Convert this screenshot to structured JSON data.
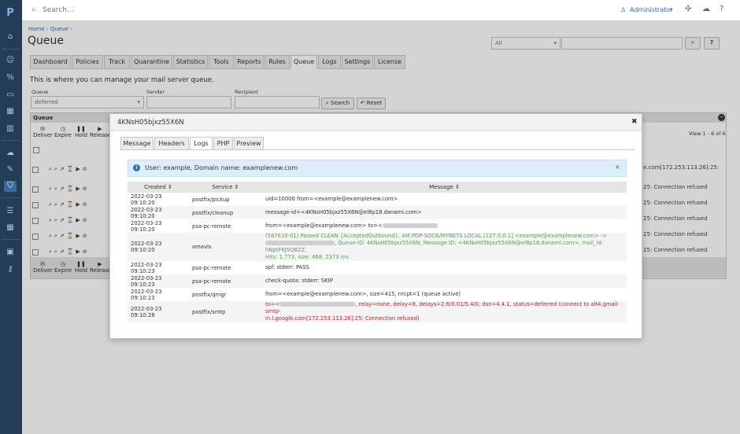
{
  "app": {
    "logo": "P"
  },
  "search": {
    "placeholder": "Search..."
  },
  "user": {
    "name": "Administrator"
  },
  "page": {
    "title": "Queue",
    "description": "This is where you can manage your mail server queue."
  },
  "breadcrumb": {
    "home": "Home",
    "current": "Queue"
  },
  "filter": {
    "select_value": "All"
  },
  "tabs": [
    "Dashboard",
    "Policies",
    "Track",
    "Quarantine",
    "Statistics",
    "Tools",
    "Reports",
    "Rules",
    "Queue",
    "Logs",
    "Settings",
    "License"
  ],
  "active_tab": "Queue",
  "form": {
    "queue_label": "Queue",
    "queue_value": "deferred",
    "sender_label": "Sender",
    "recipient_label": "Recipient",
    "search_btn": "Search",
    "reset_btn": "Reset"
  },
  "panel": {
    "title": "Queue",
    "pagination": "View 1 - 6 of 6"
  },
  "actions": {
    "deliver": "Deliver",
    "expire": "Expire",
    "hold": "Hold",
    "release": "Release"
  },
  "bg_rows": [
    "e.com[172.253.113.26]:25:",
    "25: Connection refused",
    "25: Connection refused",
    "25: Connection refused",
    "25: Connection refused",
    "25: Connection refused"
  ],
  "modal": {
    "title": "4KNsH05bjxz55X6N",
    "tabs": [
      "Message",
      "Headers",
      "Logs",
      "PHP",
      "Preview"
    ],
    "active_tab": "Logs",
    "info": "User: example, Domain name: examplenew.com",
    "columns": [
      "Created",
      "Service",
      "Message"
    ],
    "rows": [
      {
        "created": "2022-03-23 09:10:20",
        "service": "postfix/pickup",
        "message": "uid=10000 from=<example@examplenew.com>",
        "style": "normal"
      },
      {
        "created": "2022-03-23 09:10:20",
        "service": "postfix/cleanup",
        "message": "message-id=<4KNsH05bjxz55X6N@el8p18.danami.com>",
        "style": "normal"
      },
      {
        "created": "2022-03-23 09:10:20",
        "service": "psa-pc-remote",
        "message": "from=<example@examplenew.com> to=<",
        "style": "normal",
        "redacted": true
      },
      {
        "created": "2022-03-23 09:10:20",
        "service": "amavis",
        "message": "(587610-01) Passed CLEAN {AcceptedOutbound}, AM.PDP-SOCK/MYNETS LOCAL [127.0.0.1] <example@examplenew.com> ->",
        "message2": ", Queue-ID: 4KNsH05bjxz55X6N, Message-ID: <4KNsH05bjxz55X6N@el8p18.danami.com>, mail_id: hNptF6J5QBZZ,",
        "message3": "Hits: 1.773, size: 468, 2373 ms",
        "style": "green"
      },
      {
        "created": "2022-03-23 09:10:23",
        "service": "psa-pc-remote",
        "message": "spf: stderr: PASS",
        "style": "normal"
      },
      {
        "created": "2022-03-23 09:10:23",
        "service": "psa-pc-remote",
        "message": "check-quota: stderr: SKIP",
        "style": "normal"
      },
      {
        "created": "2022-03-23 09:10:23",
        "service": "postfix/qmgr",
        "message": "from=<example@examplenew.com>, size=415, nrcpt=1 (queue active)",
        "style": "normal"
      },
      {
        "created": "2022-03-23 09:10:28",
        "service": "postfix/smtp",
        "message": "to=<",
        "message2": ", relay=none, delay=8, delays=2.6/0.01/5.4/0, dsn=4.4.1, status=deferred (connect to alt4.gmail-smtp-",
        "message3": "in.l.google.com[172.253.113.26]:25: Connection refused)",
        "style": "red"
      }
    ]
  },
  "colors": {
    "sidebar": "#243d56",
    "link": "#2a73b8",
    "info_bg": "#dbeef9",
    "green": "#58a058",
    "red": "#c8222a"
  }
}
